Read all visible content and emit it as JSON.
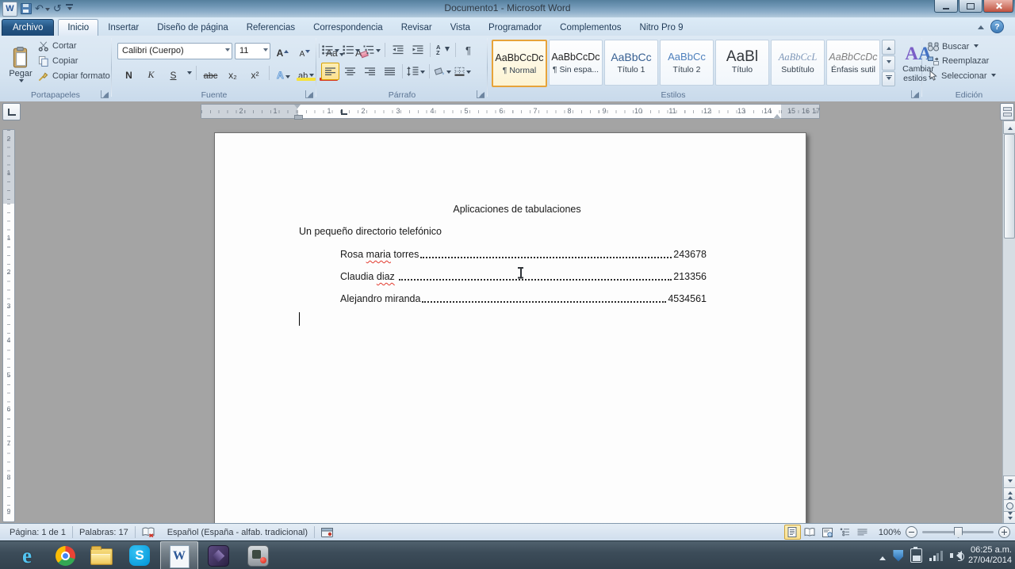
{
  "titlebar": {
    "title": "Documento1 - Microsoft Word",
    "help": "?"
  },
  "qat": {
    "word_glyph": "W",
    "undo_glyph": "↶",
    "redo_glyph": "↺"
  },
  "tabs": {
    "file": "Archivo",
    "items": [
      "Inicio",
      "Insertar",
      "Diseño de página",
      "Referencias",
      "Correspondencia",
      "Revisar",
      "Vista",
      "Programador",
      "Complementos",
      "Nitro Pro 9"
    ]
  },
  "ribbon": {
    "clipboard": {
      "group": "Portapapeles",
      "paste": "Pegar",
      "cut": "Cortar",
      "copy": "Copiar",
      "format_painter": "Copiar formato"
    },
    "font": {
      "group": "Fuente",
      "family": "Calibri (Cuerpo)",
      "size": "11",
      "bold": "N",
      "italic": "K",
      "underline": "S",
      "strikethrough": "abc",
      "subscript": "x₂",
      "superscript": "x²",
      "grow": "A",
      "shrink": "A",
      "case": "Aa",
      "clear": "A",
      "effects": "A",
      "highlight": "ab",
      "color": "A"
    },
    "paragraph": {
      "group": "Párrafo",
      "pilcrow": "¶",
      "sort": "AZ"
    },
    "styles": {
      "group": "Estilos",
      "items": [
        {
          "sample": "AaBbCcDc",
          "name": "¶ Normal"
        },
        {
          "sample": "AaBbCcDc",
          "name": "¶ Sin espa..."
        },
        {
          "sample": "AaBbCc",
          "name": "Título 1"
        },
        {
          "sample": "AaBbCc",
          "name": "Título 2"
        },
        {
          "sample": "AaBl",
          "name": "Título"
        },
        {
          "sample": "AaBbCcL",
          "name": "Subtítulo"
        },
        {
          "sample": "AaBbCcDc",
          "name": "Énfasis sutil"
        }
      ],
      "change_icon_a": "A",
      "change_icon_b": "A",
      "change_styles_1": "Cambiar",
      "change_styles_2": "estilos"
    },
    "editing": {
      "group": "Edición",
      "find": "Buscar",
      "replace": "Reemplazar",
      "select": "Seleccionar"
    }
  },
  "ruler": {
    "h_margin": [
      "2",
      "1"
    ],
    "h": [
      "1",
      "2",
      "3",
      "4",
      "5",
      "6",
      "7",
      "8",
      "9",
      "10",
      "11",
      "12",
      "13",
      "14"
    ],
    "h_right": [
      "15",
      "16",
      "17"
    ],
    "v_margin": [
      "2",
      "1"
    ],
    "v": [
      "1",
      "2",
      "3",
      "4",
      "5",
      "6",
      "7",
      "8",
      "9"
    ]
  },
  "document": {
    "heading": "Aplicaciones de tabulaciones",
    "intro": "Un pequeño directorio telefónico",
    "entries": [
      {
        "pre": "Rosa ",
        "miss": "maria",
        "post": " torres",
        "number": "243678"
      },
      {
        "pre": "Claudia ",
        "miss": "diaz",
        "post": " ",
        "number": "213356"
      },
      {
        "pre": "Alejandro miranda",
        "miss": "",
        "post": "",
        "number": "4534561"
      }
    ]
  },
  "statusbar": {
    "page": "Página: 1 de 1",
    "words": "Palabras: 17",
    "language": "Español (España - alfab. tradicional)",
    "zoom_level": "100%"
  },
  "tray": {
    "time": "06:25 a.m.",
    "date": "27/04/2014"
  },
  "colors": {
    "selection_yellow": "#fdeeb5",
    "word_blue": "#2b5797",
    "title_gradient_top": "#55809e",
    "taskbar": "#3c4c59"
  }
}
